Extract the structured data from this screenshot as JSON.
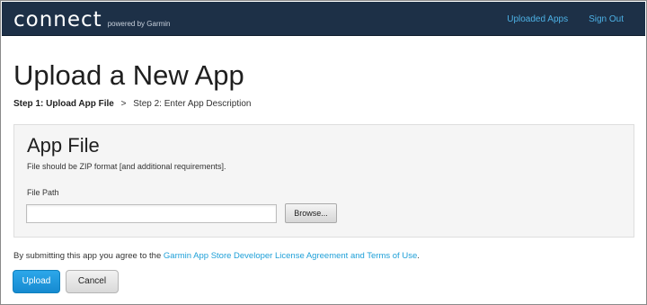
{
  "header": {
    "logo": "connect",
    "tagline": "powered by Garmin",
    "nav": {
      "uploaded_apps": "Uploaded Apps",
      "sign_out": "Sign Out"
    }
  },
  "page": {
    "title": "Upload a New App"
  },
  "steps": {
    "step1": "Step 1: Upload App File",
    "separator": ">",
    "step2": "Step 2: Enter App Description"
  },
  "app_file": {
    "title": "App File",
    "description": "File should be ZIP format [and additional requirements].",
    "file_path_label": "File Path",
    "file_path_value": "",
    "browse_label": "Browse..."
  },
  "agreement": {
    "prefix": "By submitting this app you agree to the ",
    "link": "Garmin App Store Developer License Agreement and Terms of Use",
    "suffix": "."
  },
  "actions": {
    "upload_label": "Upload",
    "cancel_label": "Cancel"
  },
  "colors": {
    "header_bg": "#1d3047",
    "link_color": "#1fa0d8",
    "nav_link_color": "#4db1e5",
    "primary_button": "#1f97dc"
  }
}
